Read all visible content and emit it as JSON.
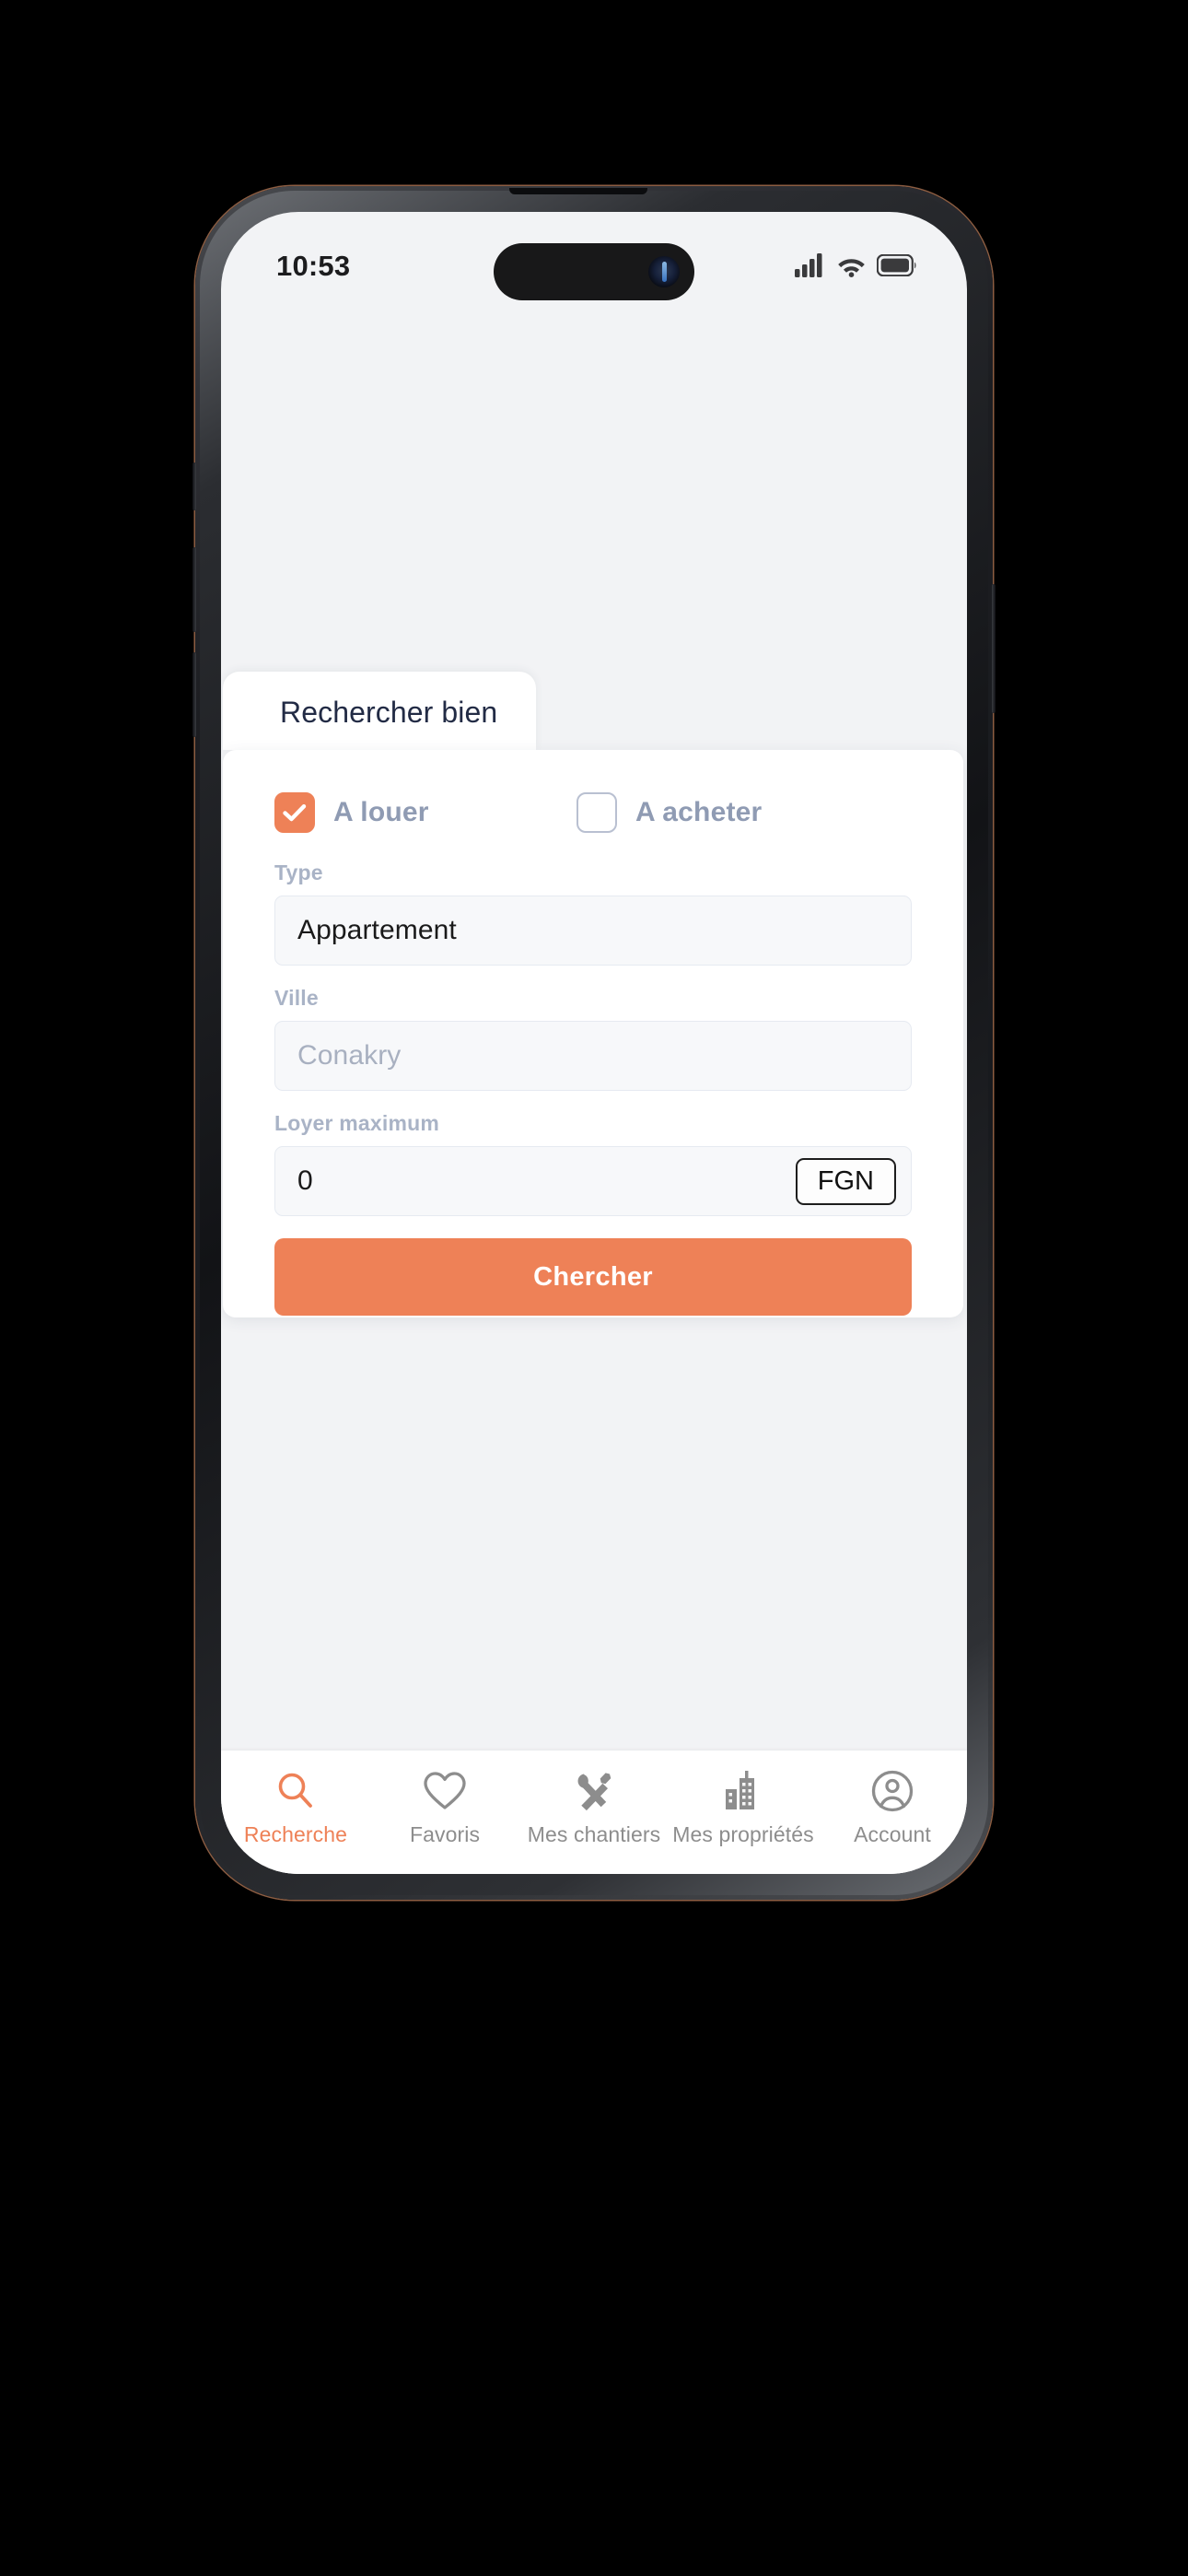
{
  "status_bar": {
    "time": "10:53",
    "signal_icon": "cellular-signal-icon",
    "wifi_icon": "wifi-icon",
    "battery_icon": "battery-icon"
  },
  "tab": {
    "label": "Rechercher bien"
  },
  "form": {
    "checkboxes": [
      {
        "label": "A louer",
        "checked": true
      },
      {
        "label": "A acheter",
        "checked": false
      }
    ],
    "fields": [
      {
        "label": "Type",
        "value": "Appartement",
        "is_placeholder": false
      },
      {
        "label": "Ville",
        "value": "Conakry",
        "is_placeholder": true
      }
    ],
    "rent": {
      "label": "Loyer maximum",
      "value": "0",
      "currency": "FGN"
    },
    "submit_label": "Chercher"
  },
  "bottom_nav": {
    "items": [
      {
        "label": "Recherche",
        "icon": "search-icon",
        "active": true
      },
      {
        "label": "Favoris",
        "icon": "heart-icon",
        "active": false
      },
      {
        "label": "Mes chantiers",
        "icon": "tools-icon",
        "active": false
      },
      {
        "label": "Mes propriétés",
        "icon": "buildings-icon",
        "active": false
      },
      {
        "label": "Account",
        "icon": "account-icon",
        "active": false
      }
    ]
  },
  "colors": {
    "accent": "#ee8157",
    "page_bg": "#f2f3f5",
    "label": "#a9b3c6",
    "nav_inactive": "#8d8d8d",
    "tab_text": "#222b45"
  }
}
